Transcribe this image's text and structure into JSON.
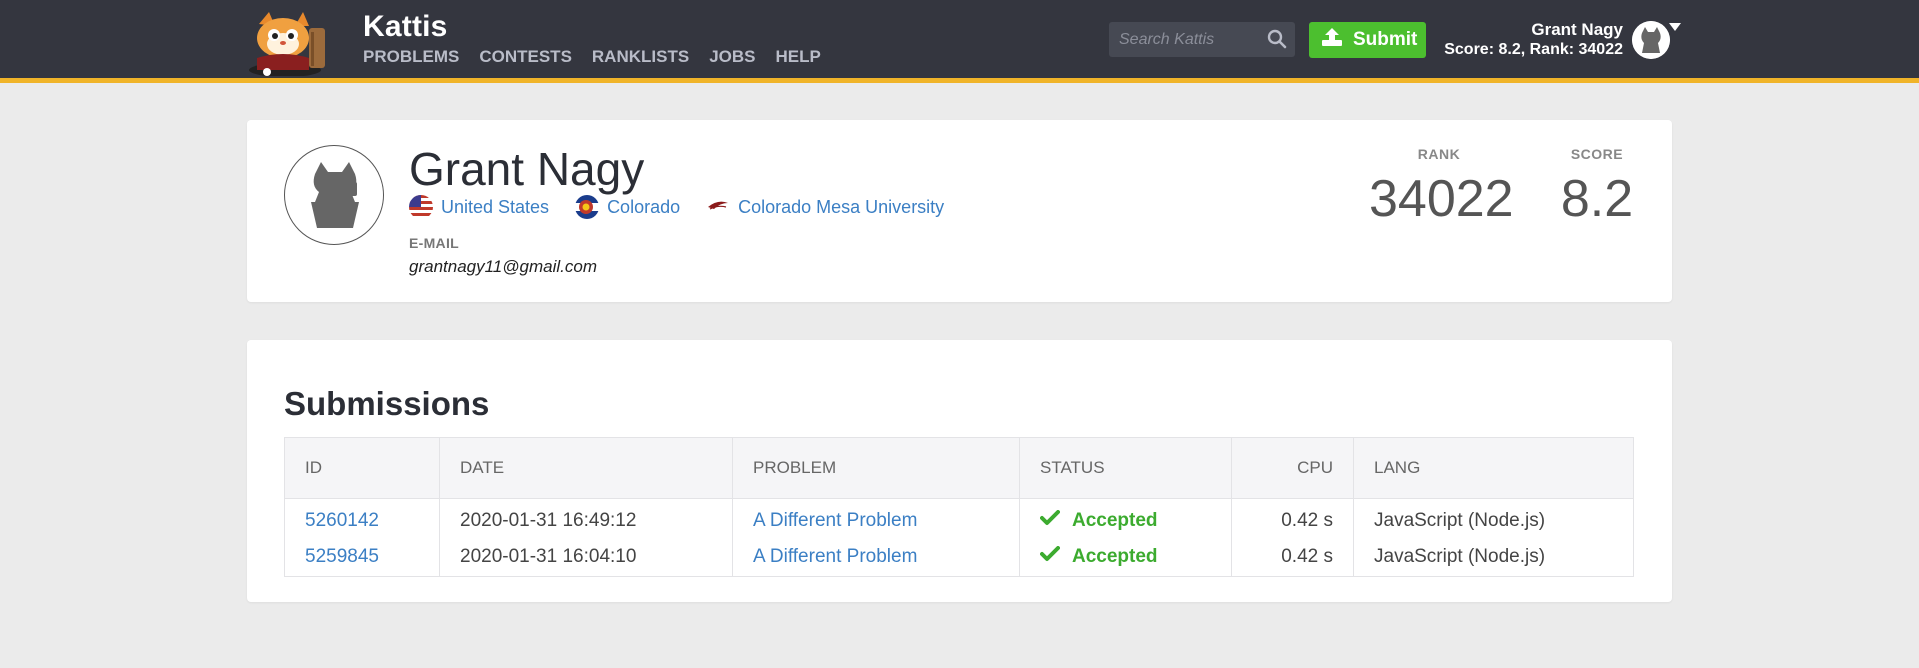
{
  "header": {
    "brand": "Kattis",
    "nav": [
      "PROBLEMS",
      "CONTESTS",
      "RANKLISTS",
      "JOBS",
      "HELP"
    ],
    "search_placeholder": "Search Kattis",
    "submit_label": "Submit",
    "user_name": "Grant Nagy",
    "user_stats": "Score: 8.2, Rank: 34022",
    "accent_color": "#f0b429",
    "submit_color": "#4cbf2f"
  },
  "profile": {
    "name": "Grant Nagy",
    "affiliations": [
      {
        "label": "United States",
        "icon": "us-flag-icon"
      },
      {
        "label": "Colorado",
        "icon": "colorado-flag-icon"
      },
      {
        "label": "Colorado Mesa University",
        "icon": "university-logo-icon"
      }
    ],
    "email_label": "E-MAIL",
    "email": "grantnagy11@gmail.com",
    "rank_label": "RANK",
    "rank": "34022",
    "score_label": "SCORE",
    "score": "8.2"
  },
  "submissions": {
    "title": "Submissions",
    "columns": [
      "ID",
      "DATE",
      "PROBLEM",
      "STATUS",
      "CPU",
      "LANG"
    ],
    "rows": [
      {
        "id": "5260142",
        "date": "2020-01-31 16:49:12",
        "problem": "A Different Problem",
        "status": "Accepted",
        "cpu": "0.42 s",
        "lang": "JavaScript (Node.js)"
      },
      {
        "id": "5259845",
        "date": "2020-01-31 16:04:10",
        "problem": "A Different Problem",
        "status": "Accepted",
        "cpu": "0.42 s",
        "lang": "JavaScript (Node.js)"
      }
    ]
  }
}
